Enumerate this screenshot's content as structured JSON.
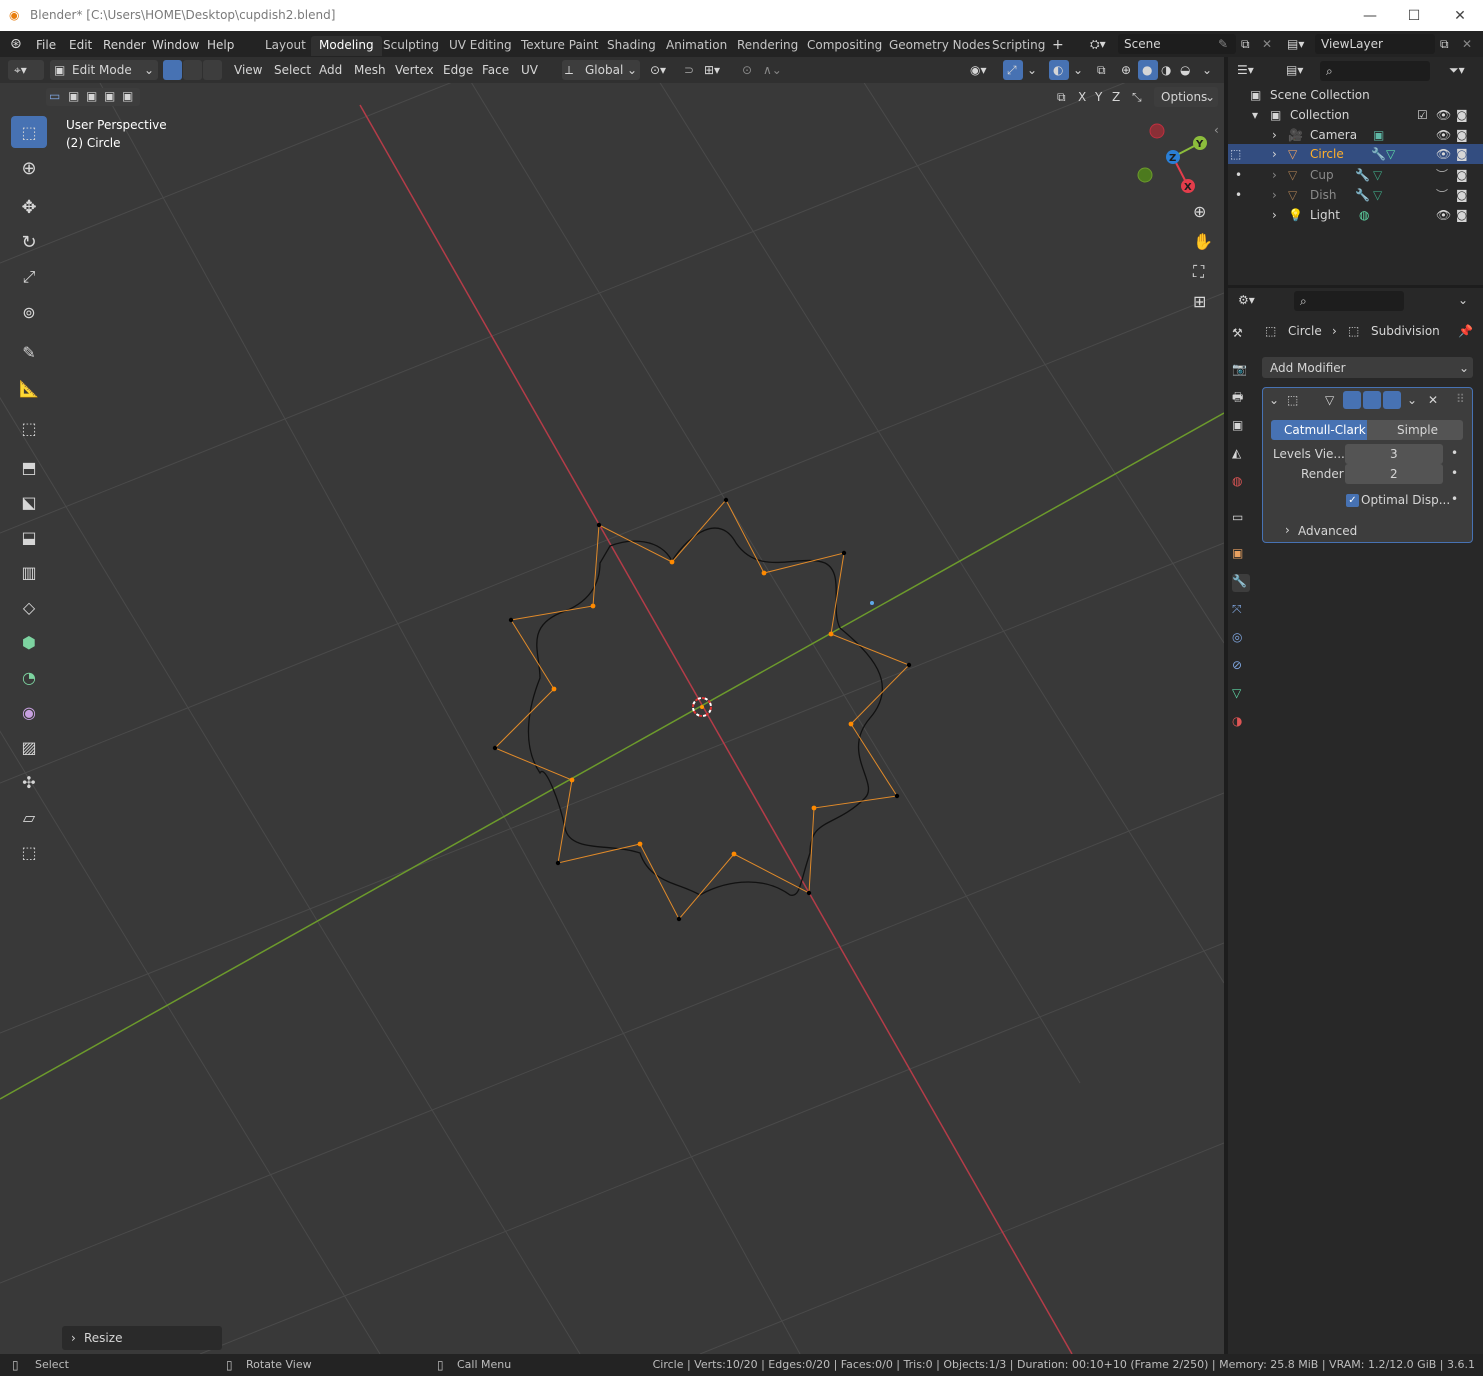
{
  "window": {
    "title": "Blender* [C:\\Users\\HOME\\Desktop\\cupdish2.blend]"
  },
  "menu": [
    "File",
    "Edit",
    "Render",
    "Window",
    "Help"
  ],
  "workspaces": [
    "Layout",
    "Modeling",
    "Sculpting",
    "UV Editing",
    "Texture Paint",
    "Shading",
    "Animation",
    "Rendering",
    "Compositing",
    "Geometry Nodes",
    "Scripting"
  ],
  "active_workspace": "Modeling",
  "scene": {
    "name": "Scene"
  },
  "view_layer": {
    "name": "ViewLayer"
  },
  "header": {
    "mode": "Edit Mode",
    "menus": [
      "View",
      "Select",
      "Add",
      "Mesh",
      "Vertex",
      "Edge",
      "Face",
      "UV"
    ],
    "transform_orientation": "Global",
    "axes": [
      "X",
      "Y",
      "Z"
    ],
    "options_label": "Options"
  },
  "viewport": {
    "view_name": "User Perspective",
    "object_label": "(2) Circle",
    "last_operator": "Resize",
    "gizmo_axes": [
      "Y",
      "Z",
      "X"
    ]
  },
  "outliner": {
    "root": "Scene Collection",
    "collection": "Collection",
    "items": [
      {
        "name": "Camera",
        "active": false,
        "dim": false
      },
      {
        "name": "Circle",
        "active": true,
        "dim": false
      },
      {
        "name": "Cup",
        "active": false,
        "dim": true
      },
      {
        "name": "Dish",
        "active": false,
        "dim": true
      },
      {
        "name": "Light",
        "active": false,
        "dim": false
      }
    ]
  },
  "properties": {
    "breadcrumb_object": "Circle",
    "breadcrumb_modifier": "Subdivision",
    "add_modifier_label": "Add Modifier",
    "modifier": {
      "type_tabs": [
        "Catmull-Clark",
        "Simple"
      ],
      "active_type": "Catmull-Clark",
      "levels_viewport_label": "Levels Vie...",
      "levels_viewport": "3",
      "render_label": "Render",
      "render": "2",
      "optimal_display_label": "Optimal Disp...",
      "optimal_display_checked": true,
      "advanced_label": "Advanced"
    }
  },
  "statusbar": {
    "select": "Select",
    "rotate": "Rotate View",
    "call_menu": "Call Menu",
    "stats": "Circle | Verts:10/20 | Edges:0/20 | Faces:0/0 | Tris:0 | Objects:1/3 | Duration: 00:10+10 (Frame 2/250) | Memory: 25.8 MiB | VRAM: 1.2/12.0 GiB | 3.6.1"
  },
  "colors": {
    "accent": "#4772b3",
    "x_axis": "#b43c48",
    "y_axis": "#6c9a2c",
    "selected_vertex": "#ff8a00",
    "active_object": "#ffaf29"
  }
}
